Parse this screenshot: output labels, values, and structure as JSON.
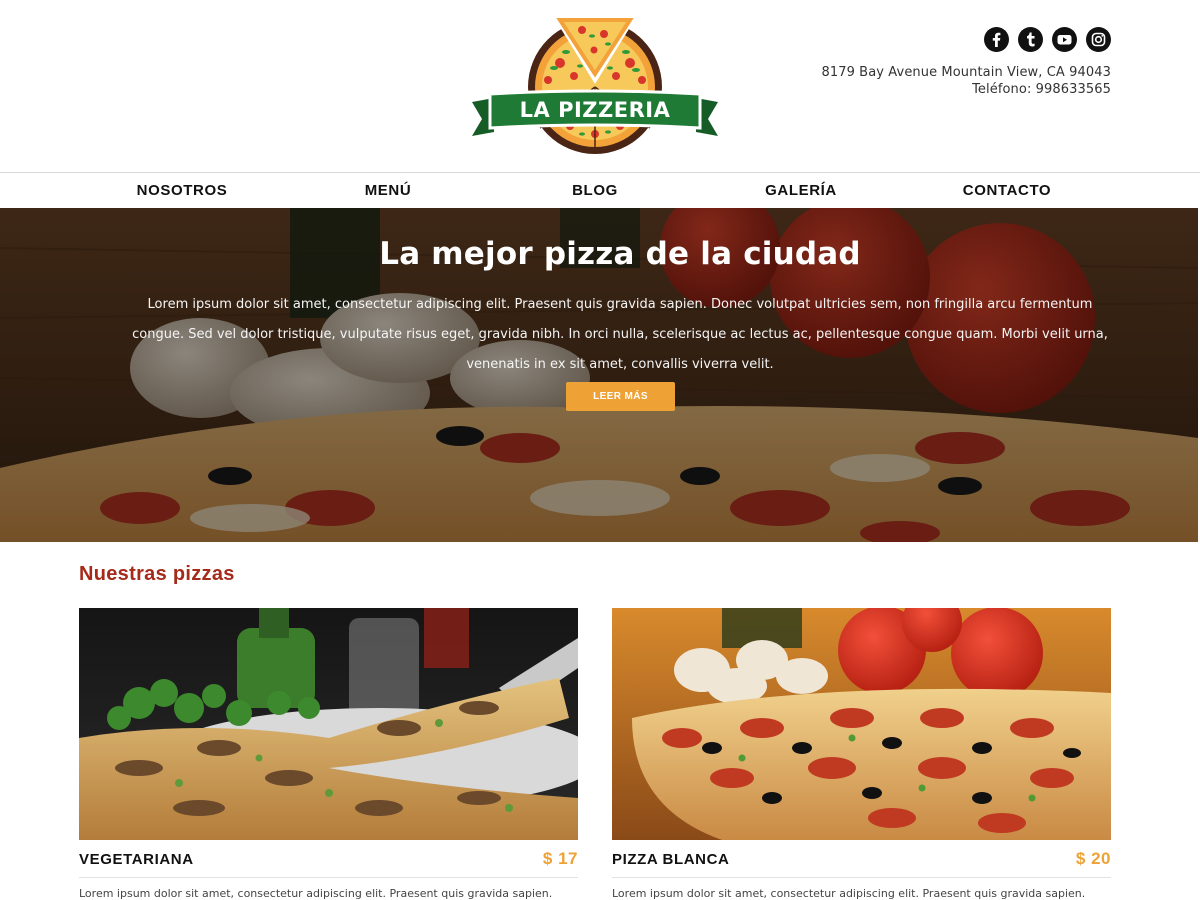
{
  "header": {
    "logo_text": "LA PIZZERIA",
    "address": "8179 Bay Avenue Mountain View, CA 94043",
    "phone": "Teléfono: 998633565",
    "social": [
      {
        "name": "facebook-icon",
        "glyph": "f"
      },
      {
        "name": "tumblr-icon",
        "glyph": "t"
      },
      {
        "name": "youtube-icon",
        "glyph": "youtube"
      },
      {
        "name": "instagram-icon",
        "glyph": "instagram"
      }
    ]
  },
  "nav": {
    "items": [
      "NOSOTROS",
      "MENÚ",
      "BLOG",
      "GALERÍA",
      "CONTACTO"
    ]
  },
  "hero": {
    "title": "La mejor pizza de la ciudad",
    "text": "Lorem ipsum dolor sit amet, consectetur adipiscing elit. Praesent quis gravida sapien. Donec volutpat ultricies sem, non fringilla arcu fermentum congue. Sed vel dolor tristique, vulputate risus eget, gravida nibh. In orci nulla, scelerisque ac lectus ac, pellentesque congue quam. Morbi velit urna, venenatis in ex sit amet, convallis viverra velit.",
    "button_label": "LEER MÁS"
  },
  "pizzas": {
    "title": "Nuestras pizzas",
    "items": [
      {
        "name": "VEGETARIANA",
        "price": "$ 17",
        "desc": "Lorem ipsum dolor sit amet, consectetur adipiscing elit. Praesent quis gravida sapien."
      },
      {
        "name": "PIZZA BLANCA",
        "price": "$ 20",
        "desc": "Lorem ipsum dolor sit amet, consectetur adipiscing elit. Praesent quis gravida sapien."
      }
    ]
  },
  "colors": {
    "accent": "#eea236",
    "section_title": "#a52a1a",
    "logo_green": "#1e7a34",
    "logo_brown": "#4a2515"
  }
}
